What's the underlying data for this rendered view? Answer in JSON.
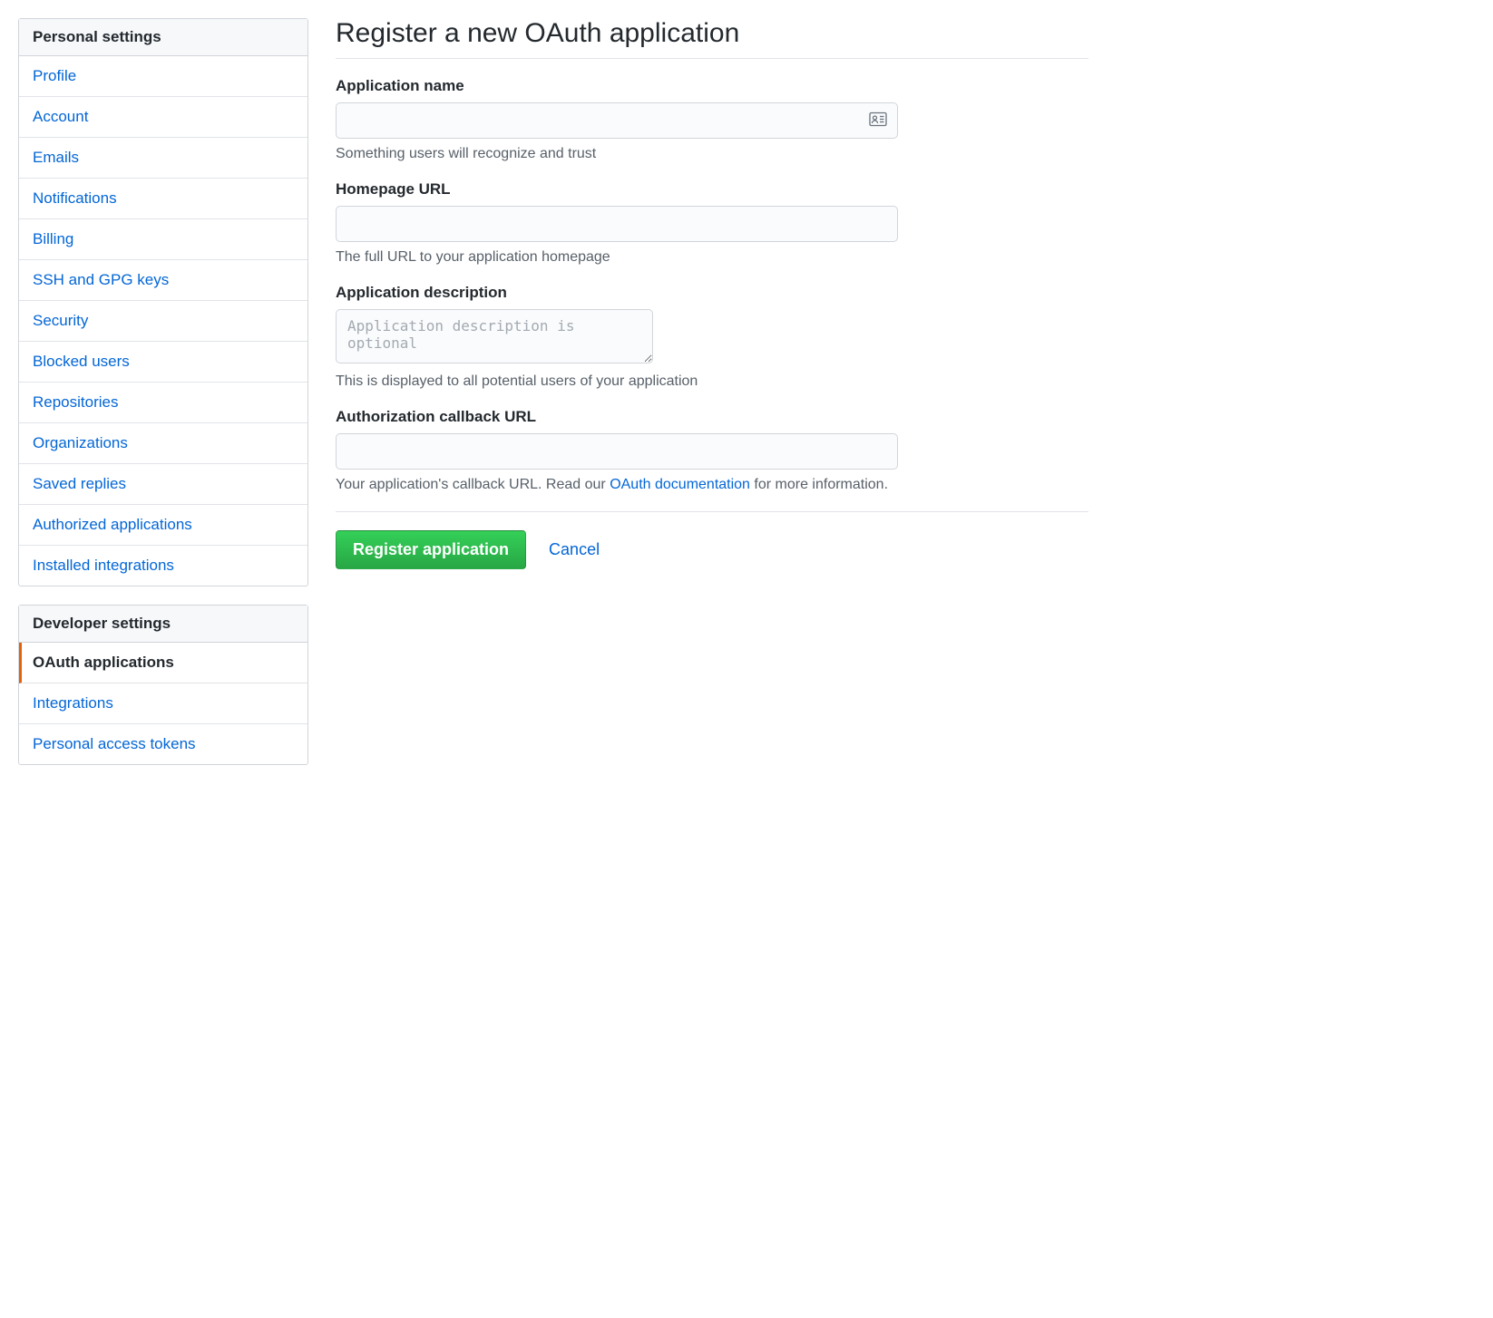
{
  "sidebar": {
    "personal": {
      "header": "Personal settings",
      "items": [
        {
          "label": "Profile"
        },
        {
          "label": "Account"
        },
        {
          "label": "Emails"
        },
        {
          "label": "Notifications"
        },
        {
          "label": "Billing"
        },
        {
          "label": "SSH and GPG keys"
        },
        {
          "label": "Security"
        },
        {
          "label": "Blocked users"
        },
        {
          "label": "Repositories"
        },
        {
          "label": "Organizations"
        },
        {
          "label": "Saved replies"
        },
        {
          "label": "Authorized applications"
        },
        {
          "label": "Installed integrations"
        }
      ]
    },
    "developer": {
      "header": "Developer settings",
      "items": [
        {
          "label": "OAuth applications",
          "active": true
        },
        {
          "label": "Integrations"
        },
        {
          "label": "Personal access tokens"
        }
      ]
    }
  },
  "page": {
    "title": "Register a new OAuth application"
  },
  "form": {
    "appName": {
      "label": "Application name",
      "value": "",
      "help": "Something users will recognize and trust"
    },
    "homepageUrl": {
      "label": "Homepage URL",
      "value": "",
      "help": "The full URL to your application homepage"
    },
    "description": {
      "label": "Application description",
      "value": "",
      "placeholder": "Application description is optional",
      "help": "This is displayed to all potential users of your application"
    },
    "callbackUrl": {
      "label": "Authorization callback URL",
      "value": "",
      "help_prefix": "Your application's callback URL. Read our ",
      "help_link": "OAuth documentation",
      "help_suffix": " for more information."
    },
    "actions": {
      "submit": "Register application",
      "cancel": "Cancel"
    }
  }
}
